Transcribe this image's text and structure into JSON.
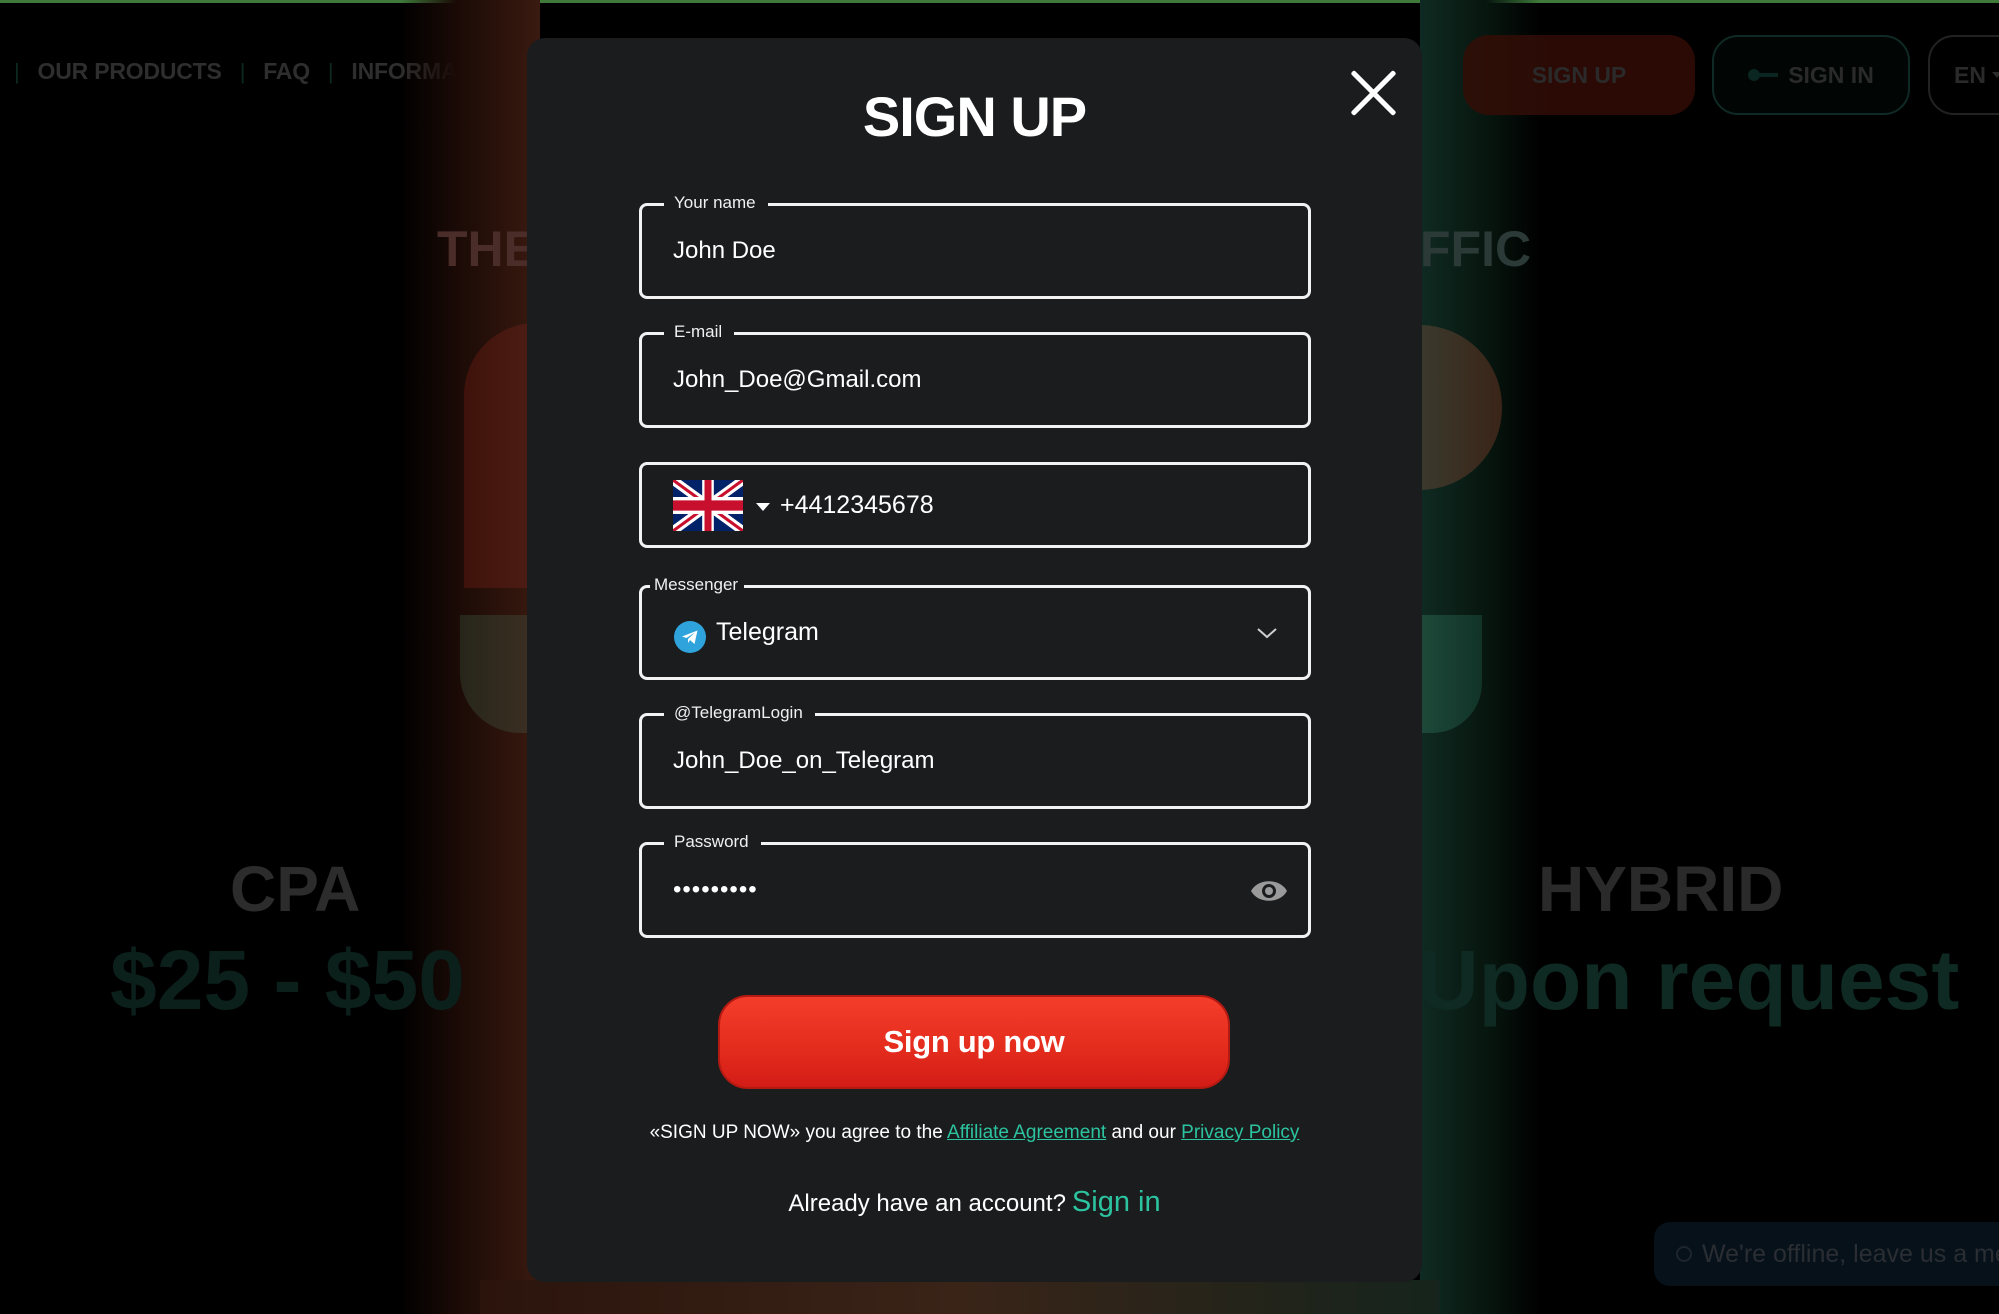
{
  "background": {
    "nav": {
      "items": [
        "OUR PRODUCTS",
        "FAQ",
        "INFORMATION"
      ]
    },
    "header_buttons": {
      "sign_up": "SIGN UP",
      "sign_in": "SIGN IN",
      "language": "EN"
    },
    "hero_title_left_fragment": "THE",
    "hero_title_right_fragment": "FFIC",
    "plans": [
      {
        "name": "CPA",
        "price": "$25 - $50"
      },
      {
        "name": "HYBRID",
        "price": "Upon request"
      }
    ],
    "chat_widget": {
      "text": "We're offline, leave us a me"
    },
    "colors": {
      "accent_red": "#e52d1e",
      "accent_green": "#2cc4a0",
      "top_line": "#3f7a3a"
    }
  },
  "modal": {
    "title": "SIGN UP",
    "close_icon": "close-icon",
    "fields": {
      "name": {
        "label": "Your name",
        "value": "John Doe"
      },
      "email": {
        "label": "E-mail",
        "value": "John_Doe@Gmail.com"
      },
      "phone": {
        "country_flag": "united-kingdom-flag",
        "value": "+4412345678"
      },
      "messenger": {
        "label": "Messenger",
        "value": "Telegram",
        "icon": "telegram-icon"
      },
      "telegram_login": {
        "label": "@TelegramLogin",
        "value": "John_Doe_on_Telegram"
      },
      "password": {
        "label": "Password",
        "value": "•••••••••",
        "toggle_icon": "eye-icon"
      }
    },
    "submit_label": "Sign up now",
    "agreement": {
      "prefix": "«SIGN UP NOW» you agree to the ",
      "link1": "Affiliate Agreement",
      "middle": " and our ",
      "link2": "Privacy Policy"
    },
    "signin_prompt": {
      "text": "Already have an account?",
      "link": "Sign in"
    },
    "colors": {
      "modal_bg": "#1b1c1e",
      "field_border": "#f2f2f2",
      "button_red": "#e52d1e",
      "link_green": "#2cc4a0",
      "telegram_blue": "#2fa3dc"
    }
  }
}
